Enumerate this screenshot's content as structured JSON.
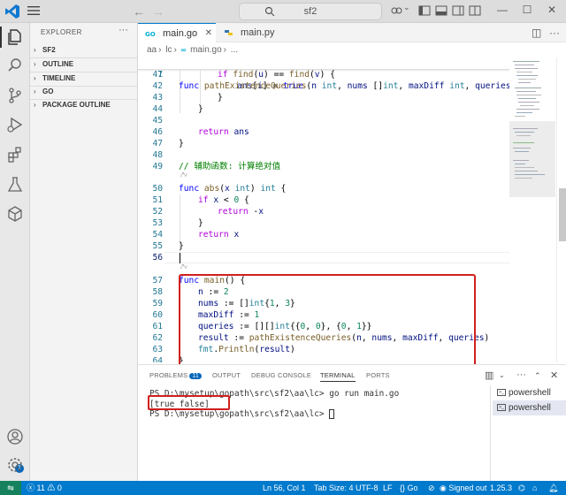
{
  "titlebar": {
    "search_text": "sf2",
    "back_icon": "arrow-left-icon",
    "forward_icon": "arrow-right-icon"
  },
  "activity_bar": {
    "items": [
      "explorer-icon",
      "search-icon",
      "source-control-icon",
      "run-debug-icon",
      "extensions-icon",
      "testing-icon",
      "docker-icon"
    ],
    "accounts_badge": "1"
  },
  "sidebar": {
    "title": "EXPLORER",
    "sections": [
      "SF2",
      "OUTLINE",
      "TIMELINE",
      "GO",
      "PACKAGE OUTLINE"
    ]
  },
  "tabs": [
    {
      "label": "main.go",
      "active": true
    },
    {
      "label": "main.py",
      "active": false
    }
  ],
  "breadcrumb": [
    "aa",
    "lc",
    "main.go",
    "..."
  ],
  "editor": {
    "sticky_line": {
      "num": "7",
      "text": "func pathExistenceQueries(n int, nums []int, maxDiff int, queries [][]"
    },
    "lines": [
      {
        "num": "41",
        "text": "if find(u) == find(v) {"
      },
      {
        "num": "42",
        "text": "ans[i] = true"
      },
      {
        "num": "43",
        "text": "}"
      },
      {
        "num": "44",
        "text": "}"
      },
      {
        "num": "45",
        "text": ""
      },
      {
        "num": "46",
        "text": "return ans"
      },
      {
        "num": "47",
        "text": "}"
      },
      {
        "num": "48",
        "text": ""
      },
      {
        "num": "49",
        "text": "// 辅助函数: 计算绝对值"
      },
      {
        "num": "50",
        "text": "func abs(x int) int {"
      },
      {
        "num": "51",
        "text": "if x < 0 {"
      },
      {
        "num": "52",
        "text": "return -x"
      },
      {
        "num": "53",
        "text": "}"
      },
      {
        "num": "54",
        "text": "return x"
      },
      {
        "num": "55",
        "text": "}"
      },
      {
        "num": "56",
        "text": ""
      },
      {
        "num": "57",
        "text": "func main() {"
      },
      {
        "num": "58",
        "text": "n := 2"
      },
      {
        "num": "59",
        "text": "nums := []int{1, 3}"
      },
      {
        "num": "60",
        "text": "maxDiff := 1"
      },
      {
        "num": "61",
        "text": "queries := [][]int{{0, 0}, {0, 1}}"
      },
      {
        "num": "62",
        "text": "result := pathExistenceQueries(n, nums, maxDiff, queries)"
      },
      {
        "num": "63",
        "text": "fmt.Println(result)"
      },
      {
        "num": "64",
        "text": "}"
      }
    ],
    "refs_label": "⤤∨"
  },
  "panel": {
    "tabs": [
      "PROBLEMS",
      "OUTPUT",
      "DEBUG CONSOLE",
      "TERMINAL",
      "PORTS"
    ],
    "problems_count": "11",
    "active_tab": "TERMINAL",
    "terminal_lines": [
      "PS D:\\mysetup\\gopath\\src\\sf2\\aa\\lc> go run main.go",
      "[true false]",
      "PS D:\\mysetup\\gopath\\src\\sf2\\aa\\lc> "
    ],
    "terminals": [
      "powershell",
      "powershell"
    ]
  },
  "statusbar": {
    "problems": "ⓧ 11 ⚠ 0",
    "position": "Ln 56, Col 1",
    "tab_size": "Tab Size: 4",
    "encoding": "UTF-8",
    "eol": "LF",
    "language": "{} Go",
    "signin": "Signed out",
    "go_version": "1.25.3"
  },
  "colors": {
    "accent": "#007acc",
    "highlight_box": "#d11f1f",
    "badge": "#0066b8"
  }
}
